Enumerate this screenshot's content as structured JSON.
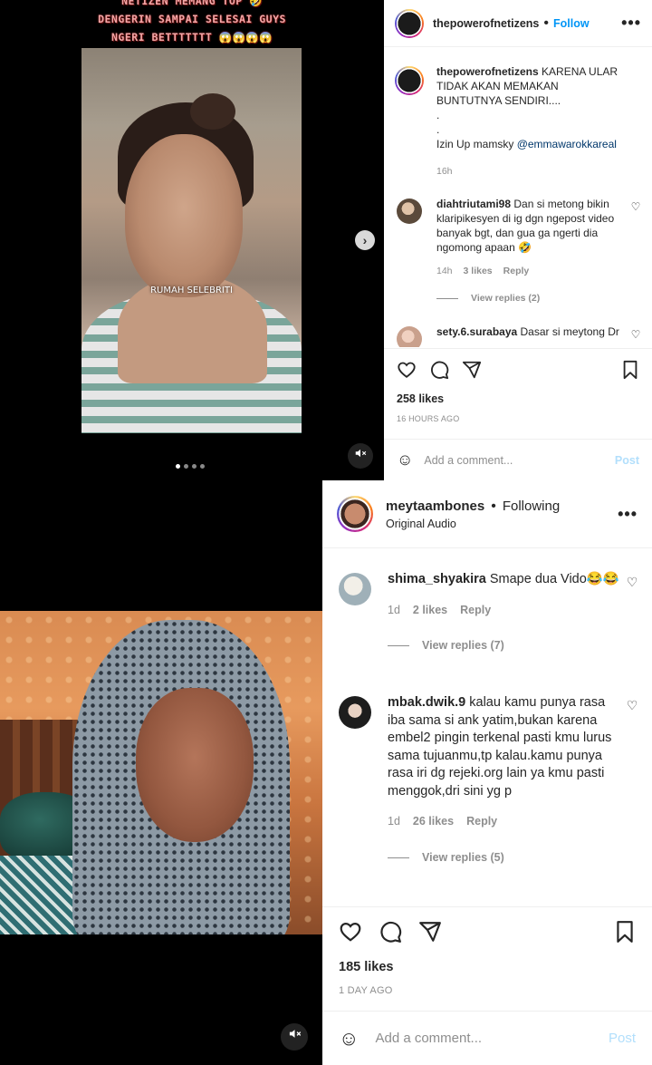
{
  "post1": {
    "video": {
      "caption_lines": [
        "NETIZEN MEMANG TOP 🤣",
        "DENGERIN SAMPAI SELESAI GUYS",
        "NGERI BETTTTTTT 😱😱😱😱"
      ],
      "watermark": "RUMAH SELEBRITI",
      "next_icon": "chevron-right-icon",
      "mute_icon": "speaker-muted-icon",
      "carousel_dots": 4
    },
    "header": {
      "username": "thepowerofnetizens",
      "separator": "•",
      "follow_label": "Follow",
      "more_label": "•••"
    },
    "caption": {
      "username": "thepowerofnetizens",
      "text": "KARENA ULAR TIDAK AKAN MEMAKAN BUNTUTNYA SENDIRI....",
      "dot1": ".",
      "dot2": ".",
      "credit_prefix": "Izin Up mamsky ",
      "credit_mention": "@emmawarokkareal",
      "time": "16h"
    },
    "comments": [
      {
        "username": "diahtriutami98",
        "text": "Dan si metong bikin klaripikesyen di ig dgn ngepost video banyak bgt, dan gua ga ngerti dia ngomong apaan 🤣",
        "time": "14h",
        "likes": "3 likes",
        "reply": "Reply",
        "view_replies": "View replies (2)"
      },
      {
        "username": "sety.6.surabaya",
        "text": "Dasar si meytong Dr"
      }
    ],
    "likes": "258 likes",
    "time_ago": "16 HOURS AGO",
    "add_comment_placeholder": "Add a comment...",
    "post_label": "Post"
  },
  "post2": {
    "header": {
      "username": "meytaambones",
      "separator": "•",
      "following_label": "Following",
      "audio": "Original Audio",
      "more_label": "•••"
    },
    "comments": [
      {
        "username": "shima_shyakira",
        "text": "Smape dua Vido😂😂",
        "time": "1d",
        "likes": "2 likes",
        "reply": "Reply",
        "view_replies": "View replies (7)"
      },
      {
        "username": "mbak.dwik.9",
        "text": "kalau kamu punya rasa iba sama si ank yatim,bukan karena embel2 pingin terkenal pasti kmu lurus sama tujuanmu,tp kalau.kamu punya rasa iri dg rejeki.org lain ya kmu pasti menggok,dri sini yg p",
        "time": "1d",
        "likes": "26 likes",
        "reply": "Reply",
        "view_replies": "View replies (5)"
      }
    ],
    "likes": "185 likes",
    "time_ago": "1 DAY AGO",
    "add_comment_placeholder": "Add a comment...",
    "post_label": "Post",
    "mute_icon": "speaker-muted-icon"
  }
}
